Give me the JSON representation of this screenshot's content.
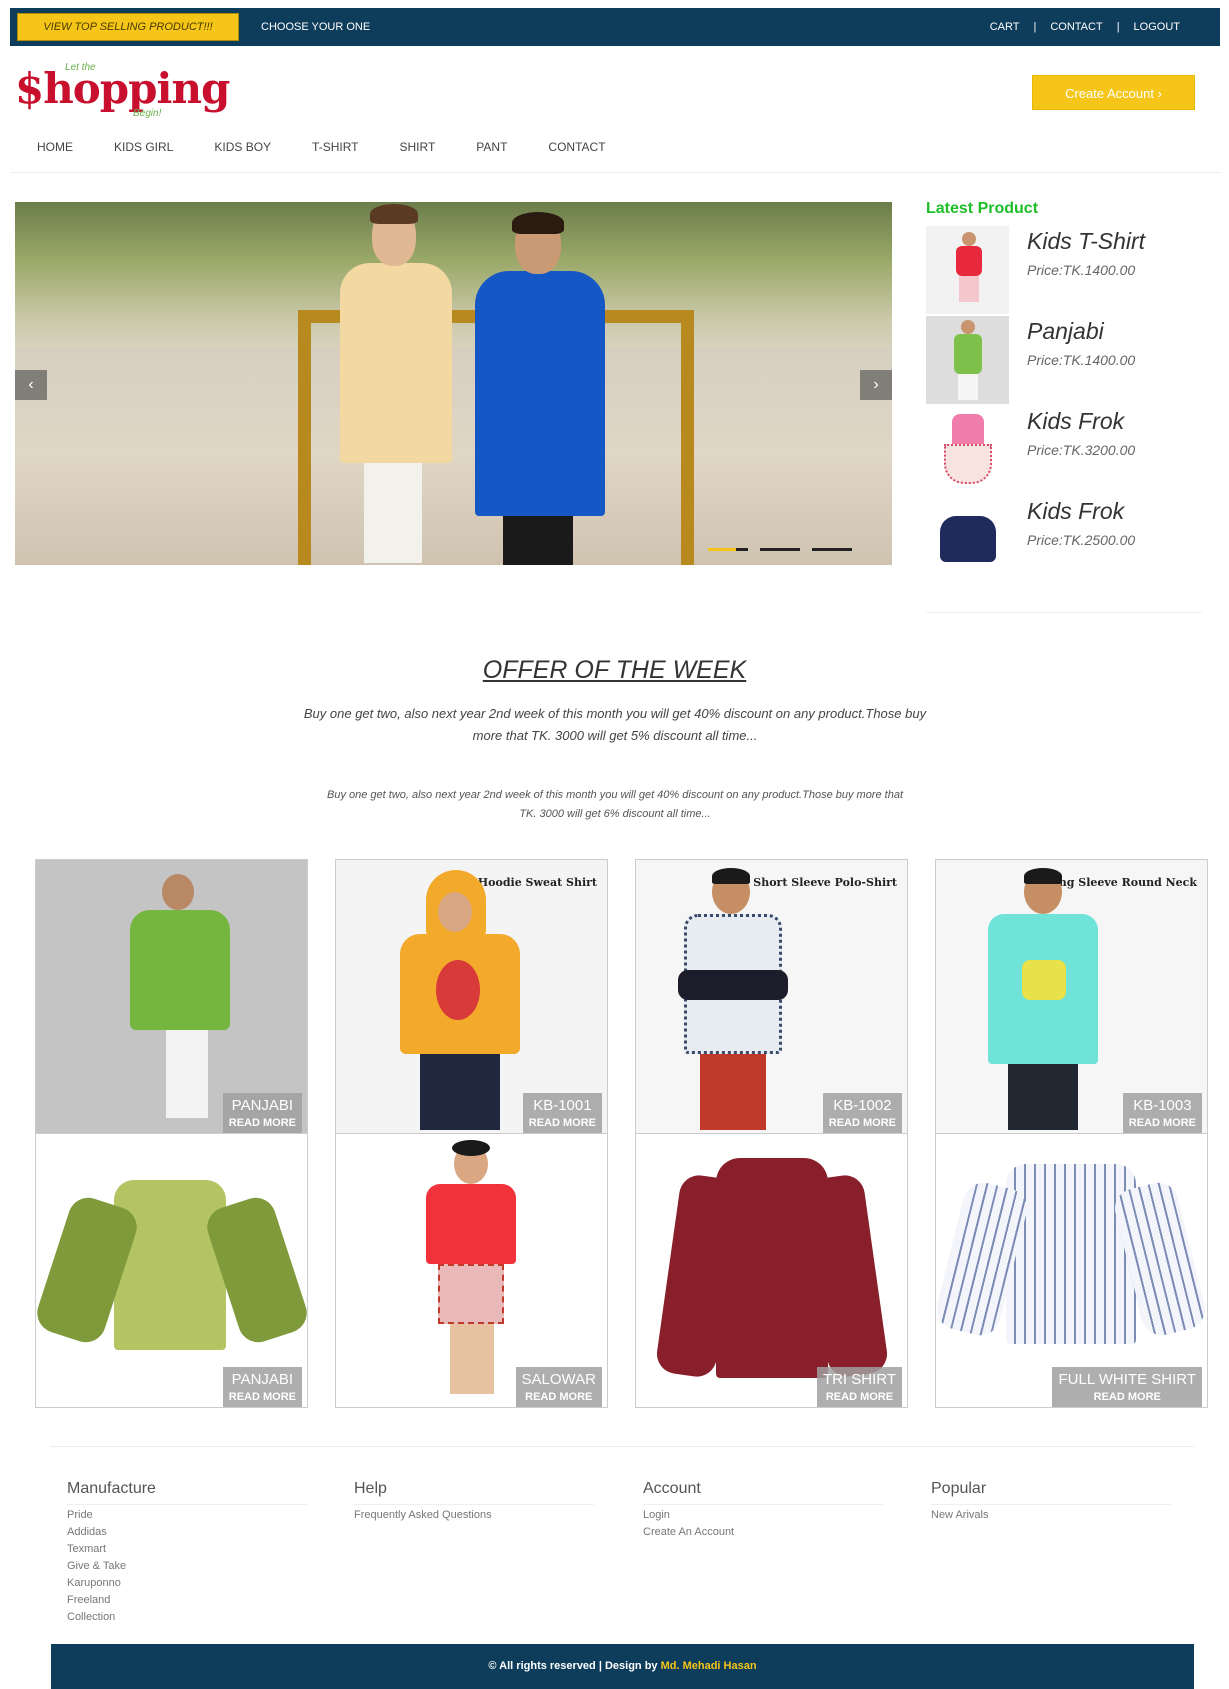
{
  "topbar": {
    "promo": "VIEW TOP SELLING PRODUCT!!!",
    "choose": "CHOOSE YOUR ONE",
    "cart": "CART",
    "contact": "CONTACT",
    "logout": "LOGOUT",
    "separator": "|"
  },
  "logo": {
    "text": "$hopping",
    "tagline_top": "Let the",
    "tagline_bottom": "Begin!"
  },
  "header": {
    "create_account": "Create Account ›"
  },
  "nav": [
    "HOME",
    "KIDS GIRL",
    "KIDS BOY",
    "T-SHIRT",
    "SHIRT",
    "PANT",
    "CONTACT"
  ],
  "slider": {
    "prev": "‹",
    "next": "›",
    "slides": 3,
    "active_slide": 1
  },
  "latest": {
    "title": "Latest Product",
    "items": [
      {
        "name": "Kids T-Shirt",
        "price": "Price:TK.1400.00"
      },
      {
        "name": "Panjabi",
        "price": "Price:TK.1400.00"
      },
      {
        "name": "Kids Frok",
        "price": "Price:TK.3200.00"
      },
      {
        "name": "Kids Frok",
        "price": "Price:TK.2500.00"
      }
    ]
  },
  "offer": {
    "title": "OFFER OF THE WEEK",
    "text1": "Buy one get two, also next year 2nd week of this month you will get 40% discount on any product.Those buy more that TK. 3000 will get 5% discount all time...",
    "text2": "Buy one get two, also next year 2nd week of this month you will get 40% discount on any product.Those buy more that TK. 3000 will get 6% discount all time..."
  },
  "products": [
    {
      "name": "PANJABI",
      "read_more": "READ MORE",
      "tag": ""
    },
    {
      "name": "KB-1001",
      "read_more": "READ MORE",
      "tag": "Hoodie Sweat Shirt"
    },
    {
      "name": "KB-1002",
      "read_more": "READ MORE",
      "tag": "Short Sleeve Polo-Shirt"
    },
    {
      "name": "KB-1003",
      "read_more": "READ MORE",
      "tag": "Long Sleeve Round Neck"
    },
    {
      "name": "PANJABI",
      "read_more": "READ MORE",
      "tag": ""
    },
    {
      "name": "SALOWAR",
      "read_more": "READ MORE",
      "tag": ""
    },
    {
      "name": "TRI SHIRT",
      "read_more": "READ MORE",
      "tag": ""
    },
    {
      "name": "FULL WHITE SHIRT",
      "read_more": "READ MORE",
      "tag": ""
    }
  ],
  "footer": {
    "columns": [
      {
        "title": "Manufacture",
        "links": [
          "Pride",
          "Addidas",
          "Texmart",
          "Give & Take",
          "Karuponno",
          "Freeland",
          "Collection"
        ]
      },
      {
        "title": "Help",
        "links": [
          "Frequently Asked Questions"
        ]
      },
      {
        "title": "Account",
        "links": [
          "Login",
          "Create An Account"
        ]
      },
      {
        "title": "Popular",
        "links": [
          "New Arivals"
        ]
      }
    ],
    "copyright": "© All rights reserved | Design by",
    "author": "Md. Mehadi Hasan"
  },
  "colors": {
    "topbar": "#0e3d5c",
    "accent": "#f5c518",
    "logo": "#c8102e",
    "latest_title": "#1fbf2a"
  }
}
